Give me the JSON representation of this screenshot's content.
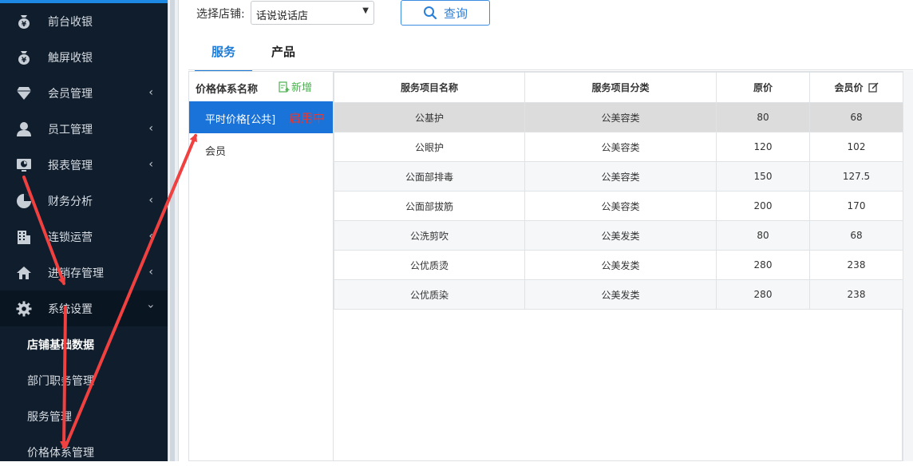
{
  "sidebar": {
    "items": [
      {
        "label": "前台收银",
        "icon": "money-bag-icon",
        "has_chevron": false
      },
      {
        "label": "触屏收银",
        "icon": "money-bag-icon",
        "has_chevron": false
      },
      {
        "label": "会员管理",
        "icon": "diamond-icon",
        "has_chevron": true
      },
      {
        "label": "员工管理",
        "icon": "user-icon",
        "has_chevron": true
      },
      {
        "label": "报表管理",
        "icon": "monitor-chart-icon",
        "has_chevron": true
      },
      {
        "label": "财务分析",
        "icon": "pie-chart-icon",
        "has_chevron": true
      },
      {
        "label": "连锁运营",
        "icon": "building-icon",
        "has_chevron": true
      },
      {
        "label": "进销存管理",
        "icon": "home-icon",
        "has_chevron": true
      },
      {
        "label": "系统设置",
        "icon": "gear-icon",
        "has_chevron": true,
        "expanded": true
      }
    ],
    "sub_items": [
      {
        "label": "店铺基础数据",
        "current": true
      },
      {
        "label": "部门职务管理",
        "current": false
      },
      {
        "label": "服务管理",
        "current": false
      },
      {
        "label": "价格体系管理",
        "current": false
      }
    ]
  },
  "filter": {
    "label": "选择店铺:",
    "store_value": "话说说话店",
    "query_label": "查询"
  },
  "tabs": [
    {
      "label": "服务",
      "active": true
    },
    {
      "label": "产品",
      "active": false
    }
  ],
  "price_list": {
    "header": "价格体系名称",
    "add_label": "新增",
    "items": [
      {
        "name": "平时价格[公共]",
        "status": "启用中",
        "active": true
      },
      {
        "name": "会员",
        "status": "",
        "active": false
      }
    ]
  },
  "table": {
    "columns": [
      "服务项目名称",
      "服务项目分类",
      "原价",
      "会员价"
    ],
    "rows": [
      {
        "name": "公基护",
        "category": "公美容类",
        "price": "80",
        "member_price": "68"
      },
      {
        "name": "公眼护",
        "category": "公美容类",
        "price": "120",
        "member_price": "102"
      },
      {
        "name": "公面部排毒",
        "category": "公美容类",
        "price": "150",
        "member_price": "127.5"
      },
      {
        "name": "公面部拔筋",
        "category": "公美容类",
        "price": "200",
        "member_price": "170"
      },
      {
        "name": "公洗剪吹",
        "category": "公美发类",
        "price": "80",
        "member_price": "68"
      },
      {
        "name": "公优质烫",
        "category": "公美发类",
        "price": "280",
        "member_price": "238"
      },
      {
        "name": "公优质染",
        "category": "公美发类",
        "price": "280",
        "member_price": "238"
      }
    ]
  },
  "colors": {
    "sidebar_bg": "#0f1d2d",
    "accent": "#1a73d9",
    "status_red": "#e53935",
    "add_green": "#4caf50",
    "annotation_red": "#f04040"
  }
}
